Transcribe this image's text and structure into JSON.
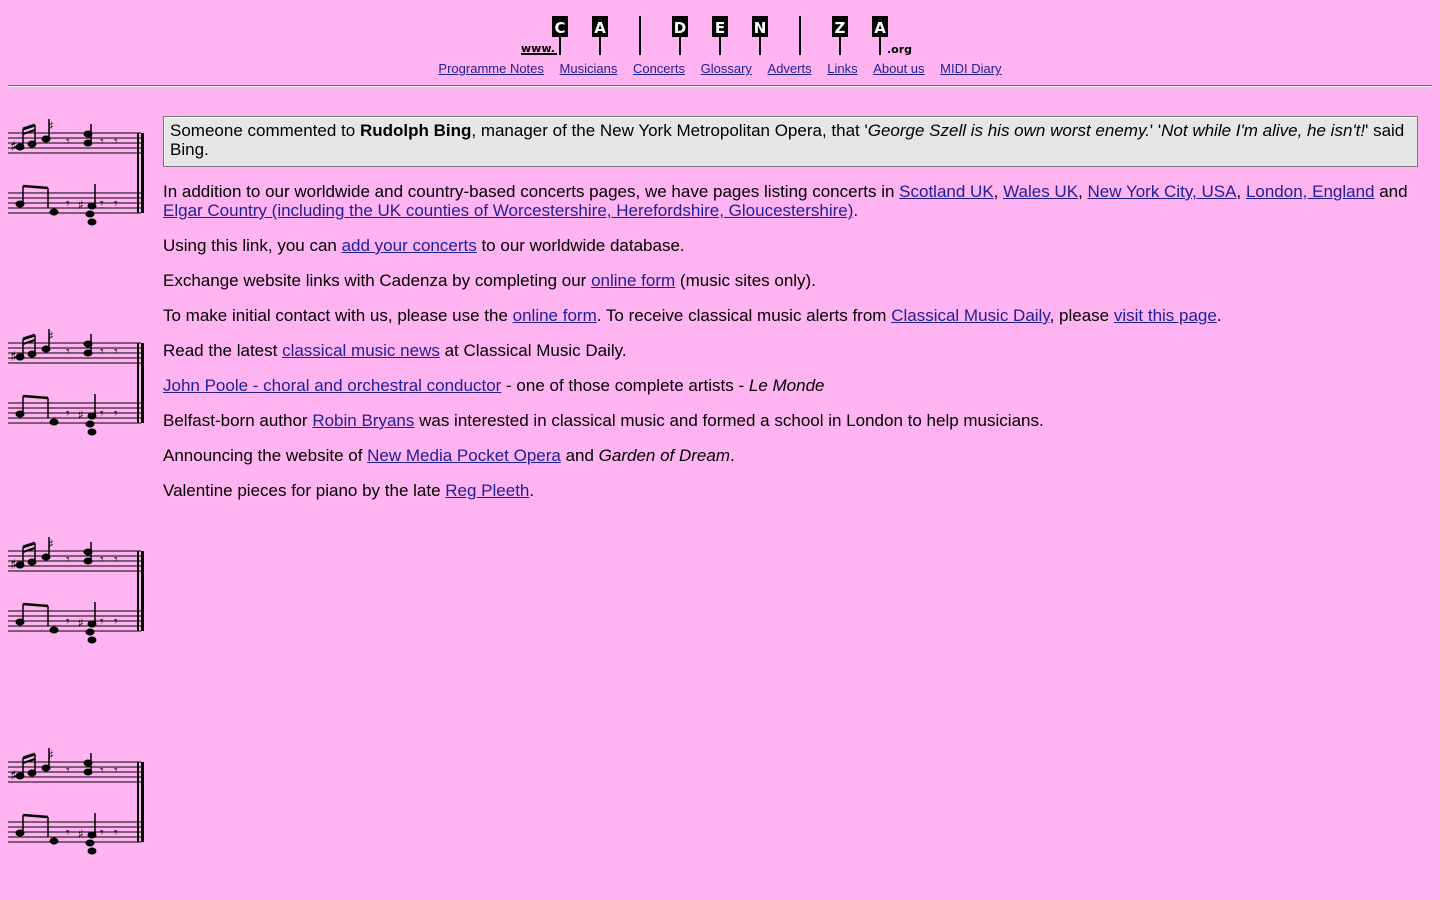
{
  "logo": {
    "prefix": "www.",
    "letters": [
      "C",
      "A",
      "D",
      "E",
      "N",
      "Z",
      "A"
    ],
    "suffix": ".org"
  },
  "nav": [
    {
      "label": "Programme Notes"
    },
    {
      "label": "Musicians"
    },
    {
      "label": "Concerts"
    },
    {
      "label": "Glossary"
    },
    {
      "label": "Adverts"
    },
    {
      "label": "Links"
    },
    {
      "label": "About us"
    },
    {
      "label": "MIDI Diary"
    }
  ],
  "quote": {
    "t1": "Someone commented to ",
    "name": "Rudolph Bing",
    "t2": ", manager of the New York Metropolitan Opera, that '",
    "q1": "George Szell is his own worst enemy.",
    "t3": "' '",
    "q2": "Not while I'm alive, he isn't!",
    "t4": "' said Bing."
  },
  "p1": {
    "t1": "In addition to our worldwide and country-based concerts pages, we have pages listing concerts in ",
    "l1": "Scotland UK",
    "s1": ", ",
    "l2": "Wales UK",
    "s2": ", ",
    "l3": "New York City, USA",
    "s3": ", ",
    "l4": "London, England",
    "s4": " and ",
    "l5": "Elgar Country (including the UK counties of Worcestershire, Herefordshire, Gloucestershire)",
    "s5": "."
  },
  "p2": {
    "t1": "Using this link, you can ",
    "l1": "add your concerts",
    "t2": " to our worldwide database."
  },
  "p3": {
    "t1": "Exchange website links with Cadenza by completing our ",
    "l1": "online form",
    "t2": " (music sites only)."
  },
  "p4": {
    "t1": "To make initial contact with us, please use the ",
    "l1": "online form",
    "t2": ". To receive classical music alerts from ",
    "l2": "Classical Music Daily",
    "t3": ", please ",
    "l3": "visit this page",
    "t4": "."
  },
  "p5": {
    "t1": "Read the latest ",
    "l1": "classical music news",
    "t2": " at Classical Music Daily."
  },
  "p6": {
    "l1": "John Poole - choral and orchestral conductor",
    "t1": " - one of those complete artists - ",
    "em": "Le Monde"
  },
  "p7": {
    "t1": "Belfast-born author ",
    "l1": "Robin Bryans",
    "t2": " was interested in classical music and formed a school in London to help musicians."
  },
  "p8": {
    "t1": "Announcing the website of ",
    "l1": "New Media Pocket Opera",
    "t2": " and ",
    "em": "Garden of Dream",
    "t3": "."
  },
  "p9": {
    "t1": "Valentine pieces for piano by the late ",
    "l1": "Reg Pleeth",
    "t2": "."
  }
}
